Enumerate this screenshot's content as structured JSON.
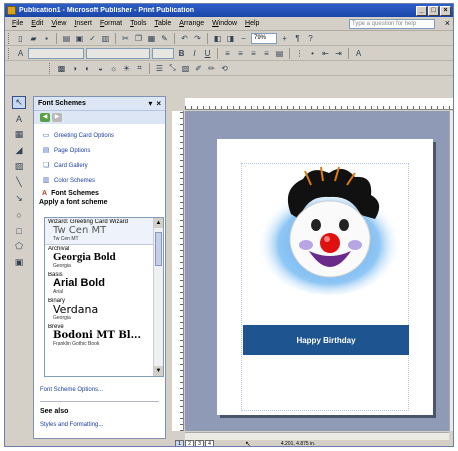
{
  "window": {
    "title": "Publication1 - Microsoft Publisher - Print Publication",
    "controls": [
      "_",
      "□",
      "×"
    ]
  },
  "menubar": {
    "items": [
      "File",
      "Edit",
      "View",
      "Insert",
      "Format",
      "Tools",
      "Table",
      "Arrange",
      "Window",
      "Help"
    ],
    "help_placeholder": "Type a question for help",
    "close_doc": "×"
  },
  "toolbar": {
    "zoom": "79%"
  },
  "taskpane": {
    "title": "Font Schemes",
    "nav_back": "◀",
    "nav_forward": "▶",
    "links": [
      {
        "label": "Greeting Card Options",
        "icon": "card-icon"
      },
      {
        "label": "Page Options",
        "icon": "page-icon"
      },
      {
        "label": "Card Gallery",
        "icon": "gallery-icon"
      },
      {
        "label": "Color Schemes",
        "icon": "palette-icon"
      }
    ],
    "font_schemes_label": "Font Schemes",
    "apply_label": "Apply a font scheme",
    "schemes": [
      {
        "name": "Wizard: Greeting Card Wizard",
        "major": "Tw Cen MT",
        "minor": "Tw Cen MT"
      },
      {
        "name": "Archival",
        "major": "Georgia Bold",
        "minor": "Georgia"
      },
      {
        "name": "Basis",
        "major": "Arial Bold",
        "minor": "Arial"
      },
      {
        "name": "Binary",
        "major": "Verdana",
        "minor": "Georgia"
      },
      {
        "name": "Breve",
        "major": "Bodoni MT Bl...",
        "minor": "Franklin Gothic Book"
      }
    ],
    "options_link": "Font Scheme Options...",
    "see_also": "See also",
    "styles_link": "Styles and Formatting..."
  },
  "publication": {
    "banner_text": "Happy Birthday"
  },
  "statusbar": {
    "pages": [
      "1",
      "2",
      "3",
      "4"
    ],
    "position": "4.201, 4.875 in."
  }
}
